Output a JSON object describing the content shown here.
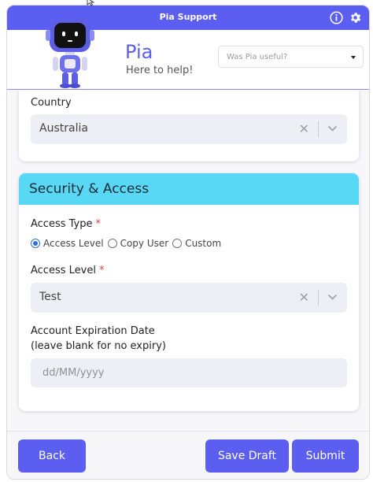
{
  "window": {
    "title": "Pia Support"
  },
  "header": {
    "name": "Pia",
    "tagline": "Here to help!",
    "feedback_placeholder": "Was Pia useful?"
  },
  "country": {
    "label": "Country",
    "value": "Australia"
  },
  "security": {
    "section_title": "Security & Access",
    "access_type_label": "Access Type",
    "required_mark": "*",
    "access_type_options": [
      "Access Level",
      "Copy User",
      "Custom"
    ],
    "access_level_label": "Access Level",
    "access_level_value": "Test",
    "expiry_label_line1": "Account Expiration Date",
    "expiry_label_line2": "(leave blank for no expiry)",
    "expiry_placeholder": "dd/MM/yyyy"
  },
  "footer": {
    "back": "Back",
    "save_draft": "Save Draft",
    "submit": "Submit"
  },
  "colors": {
    "brand": "#5b5ef0",
    "section_header": "#59d8f5",
    "required": "#e23b3b"
  },
  "icons": [
    "info-icon",
    "gear-icon",
    "clear-icon",
    "chevron-down-icon"
  ]
}
